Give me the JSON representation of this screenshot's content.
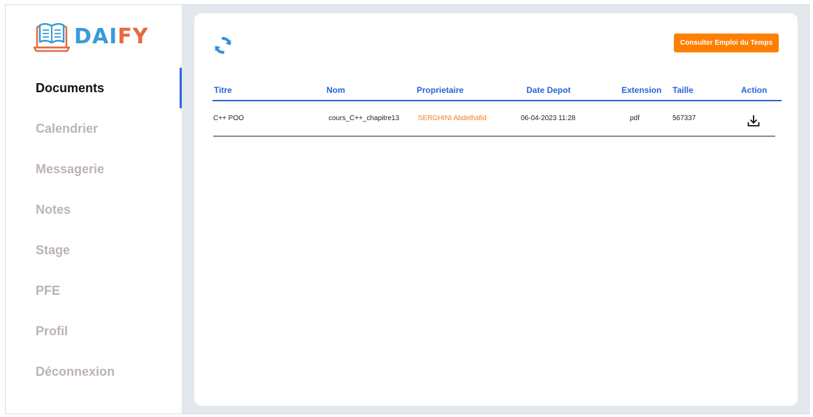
{
  "brand": {
    "name_part_a": "DAI",
    "name_part_b": "FY",
    "color_a": "#3a9bd9",
    "color_b": "#e46b3f",
    "icon": "book-laptop-icon"
  },
  "sidebar": {
    "items": [
      {
        "label": "Documents",
        "active": true
      },
      {
        "label": "Calendrier",
        "active": false
      },
      {
        "label": "Messagerie",
        "active": false
      },
      {
        "label": "Notes",
        "active": false
      },
      {
        "label": "Stage",
        "active": false
      },
      {
        "label": "PFE",
        "active": false
      },
      {
        "label": "Profil",
        "active": false
      },
      {
        "label": "Déconnexion",
        "active": false
      }
    ]
  },
  "toolbar": {
    "refresh_icon": "refresh-icon",
    "schedule_button": "Consulter Emploi du Temps"
  },
  "table": {
    "columns": [
      "Titre",
      "Nom",
      "Proprietaire",
      "Date Depot",
      "Extension",
      "Taille",
      "Action"
    ],
    "rows": [
      {
        "titre": "C++ POO",
        "nom": "cours_C++_chapitre13",
        "proprietaire": "SERGHINI Abdelhafid",
        "date_depot": "06-04-2023 11:28",
        "extension": "pdf",
        "taille": "567337",
        "action_icon": "download-icon"
      }
    ]
  },
  "colors": {
    "accent_blue": "#2a62d8",
    "button_orange": "#ff7f00",
    "owner_orange": "#f07e1b",
    "background": "#e3e8ee"
  }
}
